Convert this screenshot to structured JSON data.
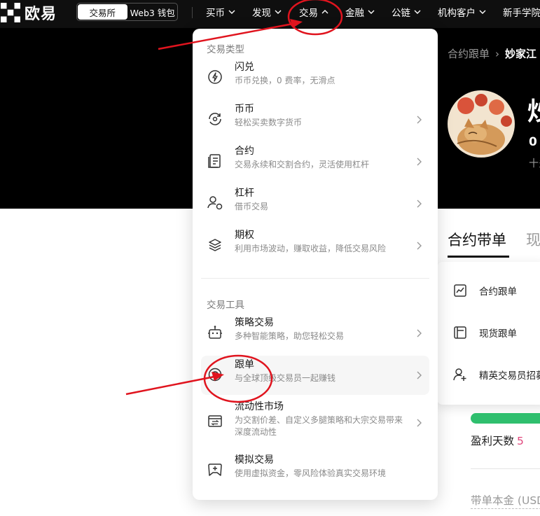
{
  "topbar": {
    "logo_text": "欧易",
    "segments": [
      "交易所",
      "Web3 钱包"
    ],
    "nav": [
      "买币",
      "发现",
      "交易",
      "金融",
      "公链",
      "机构客户",
      "新手学院"
    ]
  },
  "profile": {
    "breadcrumb": [
      "合约跟单",
      "妙家江"
    ],
    "name": "炒",
    "stat": "0",
    "sub": "十多",
    "tabs": [
      "合约带单",
      "现"
    ],
    "submenu": [
      "合约跟单",
      "现货跟单",
      "精英交易员招募"
    ],
    "profit_label": "盈利天数",
    "profit_days": "5",
    "capital_label": "带单本金 (USD"
  },
  "dropdown": {
    "section_trade": "交易类型",
    "trade_items": [
      {
        "title": "闪兑",
        "desc": "币币兑换，0 费率，无滑点",
        "icon": "flash-icon"
      },
      {
        "title": "币币",
        "desc": "轻松买卖数字货币",
        "icon": "coin-swap-icon"
      },
      {
        "title": "合约",
        "desc": "交易永续和交割合约，灵活使用杠杆",
        "icon": "contract-icon"
      },
      {
        "title": "杠杆",
        "desc": "借币交易",
        "icon": "leverage-icon"
      },
      {
        "title": "期权",
        "desc": "利用市场波动，赚取收益，降低交易风险",
        "icon": "layers-icon"
      }
    ],
    "section_tools": "交易工具",
    "tool_items": [
      {
        "title": "策略交易",
        "desc": "多种智能策略，助您轻松交易",
        "icon": "robot-icon"
      },
      {
        "title": "跟单",
        "desc": "与全球顶级交易员一起赚钱",
        "icon": "copy-trade-icon"
      },
      {
        "title": "流动性市场",
        "desc": "为交割价差、自定义多腿策略和大宗交易带来深度流动性",
        "icon": "liquidity-icon"
      },
      {
        "title": "模拟交易",
        "desc": "使用虚拟资金，零风险体验真实交易环境",
        "icon": "demo-trade-icon"
      }
    ]
  },
  "colors": {
    "topbar": "#0f0f0f",
    "annotation": "#e0141e",
    "profit": "#e0457b",
    "progress": "#2fbf6e"
  }
}
